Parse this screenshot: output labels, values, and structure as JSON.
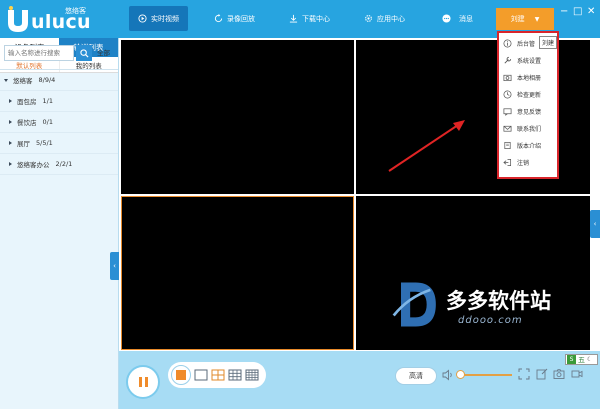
{
  "app": {
    "brand": "ulucu",
    "brand_cn": "悠络客"
  },
  "nav": {
    "live": "实时视频",
    "playback": "录像回放",
    "download": "下载中心",
    "apps": "应用中心",
    "messages": "消息",
    "user": "刘建"
  },
  "sidebar": {
    "tab_device_list": "设备列表",
    "tab_patrol_list": "轮巡列表",
    "subtab_default": "默认列表",
    "subtab_mine": "我的列表",
    "search_placeholder": "输入名称进行搜索",
    "all_button": "全部",
    "tree": [
      {
        "name": "悠络客",
        "count": "8/9/4"
      },
      {
        "name": "面包房",
        "count": "1/1"
      },
      {
        "name": "餐饮店",
        "count": "0/1"
      },
      {
        "name": "展厅",
        "count": "5/5/1"
      },
      {
        "name": "悠络客办公",
        "count": "2/2/1"
      }
    ]
  },
  "menu": {
    "items": [
      "后台管",
      "系统设置",
      "本地相册",
      "检查更新",
      "意见反馈",
      "联系我们",
      "版本介绍",
      "注销"
    ],
    "tooltip": "刘建"
  },
  "controls": {
    "quality": "高清",
    "active_layout": "1x1"
  },
  "ime": {
    "label": "五"
  },
  "watermark": {
    "title": "多多软件站",
    "url": "ddooo.com"
  },
  "colors": {
    "brand_blue": "#27a4e0",
    "accent_orange": "#f39d2a",
    "menu_border": "#d9252b",
    "selected_cell_border": "#e88a2a"
  }
}
